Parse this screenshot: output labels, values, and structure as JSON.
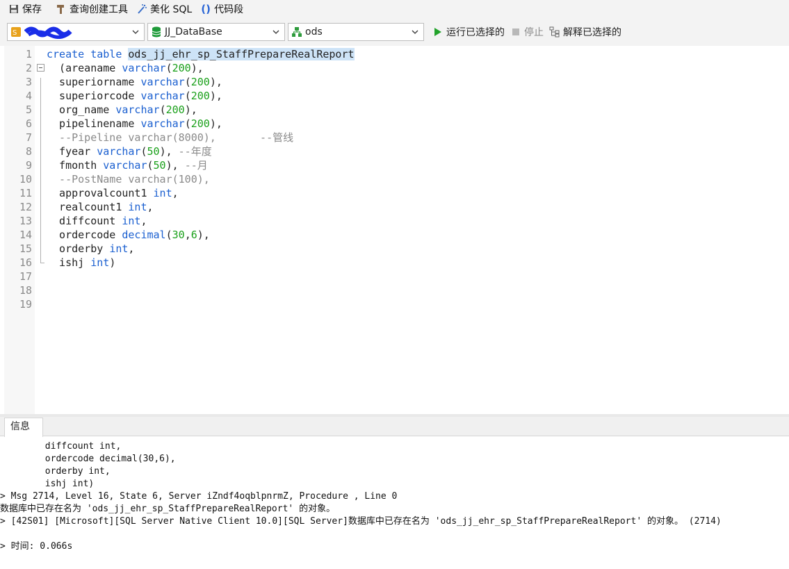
{
  "toolbar": {
    "save_label": "保存",
    "query_builder_label": "查询创建工具",
    "beautify_label": "美化 SQL",
    "snippet_label": "代码段"
  },
  "connection_bar": {
    "connection_name": "",
    "database": "JJ_DataBase",
    "schema": "ods",
    "run_selected_label": "运行已选择的",
    "stop_label": "停止",
    "explain_selected_label": "解释已选择的"
  },
  "editor": {
    "line_numbers": [
      "1",
      "2",
      "3",
      "4",
      "5",
      "6",
      "7",
      "8",
      "9",
      "10",
      "11",
      "12",
      "13",
      "14",
      "15",
      "16",
      "17",
      "18",
      "19"
    ],
    "tokens": {
      "l1a": "create table ",
      "l1b": "ods_jj_ehr_sp_StaffPrepareRealReport",
      "l2a": "  (areaname ",
      "l2b": "varchar",
      "l2c": "(",
      "l2d": "200",
      "l2e": "),",
      "l3a": "  superiorname ",
      "l3b": "varchar",
      "l3c": "(",
      "l3d": "200",
      "l3e": "),",
      "l4a": "  superiorcode ",
      "l4b": "varchar",
      "l4c": "(",
      "l4d": "200",
      "l4e": "),",
      "l5a": "  org_name ",
      "l5b": "varchar",
      "l5c": "(",
      "l5d": "200",
      "l5e": "),",
      "l6a": "  pipelinename ",
      "l6b": "varchar",
      "l6c": "(",
      "l6d": "200",
      "l6e": "),",
      "l7a": "  --Pipeline varchar(8000),       --管线",
      "l8a": "  fyear ",
      "l8b": "varchar",
      "l8c": "(",
      "l8d": "50",
      "l8e": "), ",
      "l8f": "--年度",
      "l9a": "  fmonth ",
      "l9b": "varchar",
      "l9c": "(",
      "l9d": "50",
      "l9e": "), ",
      "l9f": "--月",
      "l10a": "  --PostName varchar(100),",
      "l11a": "  approvalcount1 ",
      "l11b": "int",
      "l11c": ",",
      "l12a": "  realcount1 ",
      "l12b": "int",
      "l12c": ",",
      "l13a": "  diffcount ",
      "l13b": "int",
      "l13c": ",",
      "l14a": "  ordercode ",
      "l14b": "decimal",
      "l14c": "(",
      "l14d": "30",
      "l14e": ",",
      "l14f": "6",
      "l14g": "),",
      "l15a": "  orderby ",
      "l15b": "int",
      "l15c": ",",
      "l16a": "  ishj ",
      "l16b": "int",
      "l16c": ")"
    }
  },
  "info_panel": {
    "tab_label": "信息",
    "messages": [
      "       diffcount int,",
      "       ordercode decimal(30,6),",
      "       orderby int,",
      "       ishj int)",
      "> Msg 2714, Level 16, State 6, Server iZndf4oqblpnrmZ, Procedure , Line 0",
      "数据库中已存在名为 'ods_jj_ehr_sp_StaffPrepareRealReport' 的对象。",
      "> [42S01] [Microsoft][SQL Server Native Client 10.0][SQL Server]数据库中已存在名为 'ods_jj_ehr_sp_StaffPrepareRealReport' 的对象。 (2714)",
      "",
      "> 时间: 0.066s"
    ]
  },
  "colors": {
    "keyword": "#1a5fd0",
    "number": "#1aa01a",
    "comment": "#8a8a8a",
    "selection": "#cde3f7",
    "run_icon": "#22a32b",
    "database_icon": "#1f9b3a",
    "schema_icon": "#2e9b3c"
  },
  "icons": [
    "save-icon",
    "query-builder-icon",
    "beautify-sql-icon",
    "snippet-icon",
    "connection-icon",
    "database-icon",
    "schema-icon",
    "run-icon",
    "stop-icon",
    "explain-icon",
    "chevron-down-icon"
  ]
}
